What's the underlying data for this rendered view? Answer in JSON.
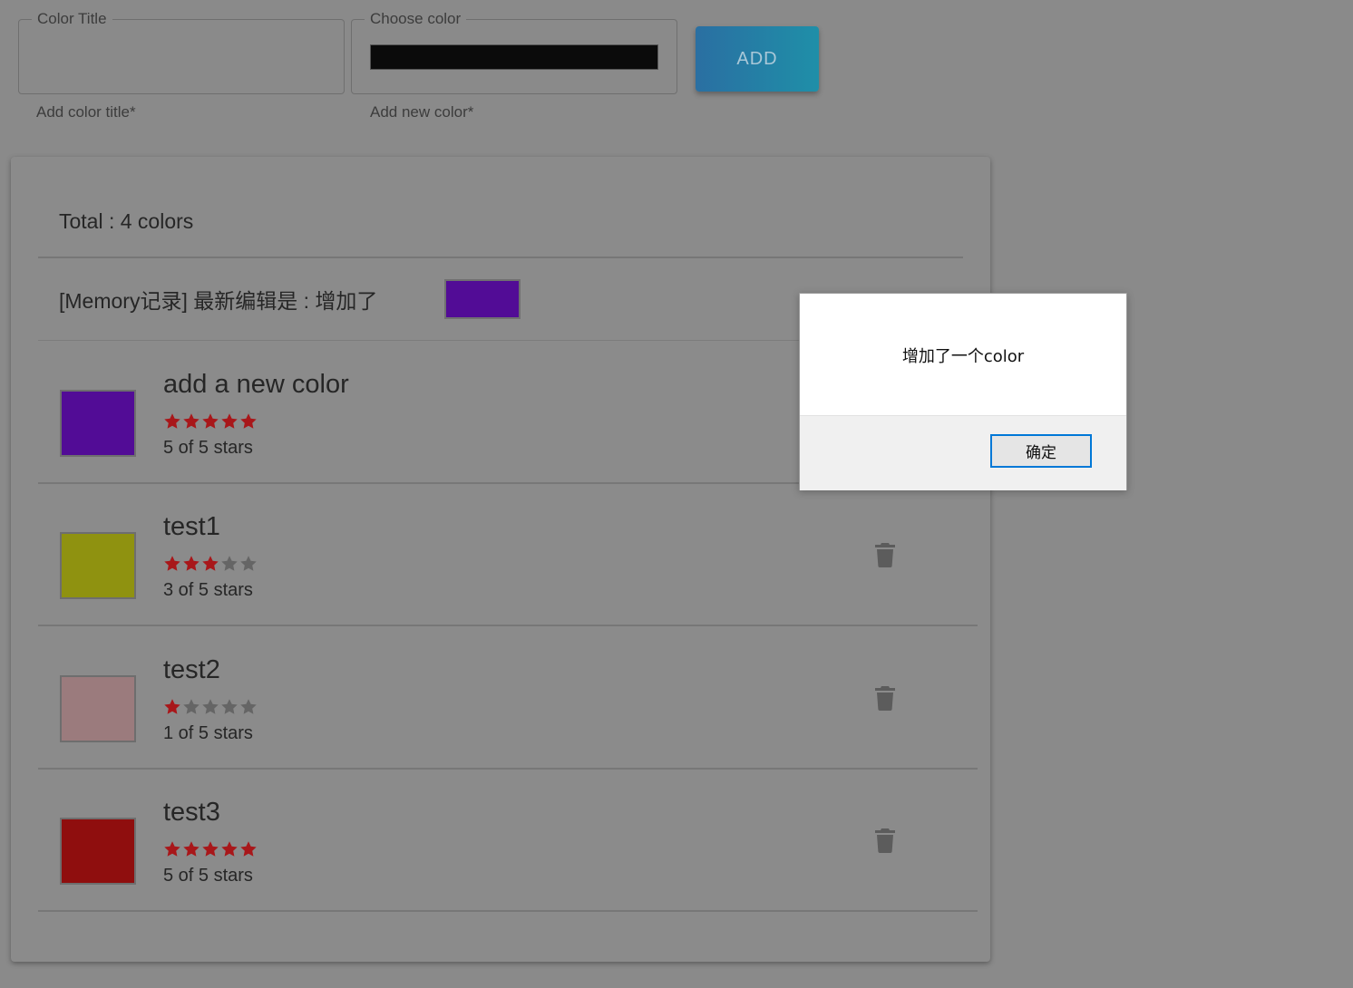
{
  "form": {
    "title_field": {
      "legend": "Color Title",
      "value": "",
      "helper": "Add color title*"
    },
    "color_field": {
      "legend": "Choose color",
      "value_color": "#0b0b0b",
      "helper": "Add new color*"
    },
    "add_label": "ADD"
  },
  "summary": {
    "total_text": "Total : 4 colors",
    "memory_text": "[Memory记录] 最新编辑是 : 增加了",
    "memory_color": "#520c96"
  },
  "colors": [
    {
      "title": "add a new color",
      "color": "#520c96",
      "rating": 5,
      "max": 5,
      "caption": "5 of 5 stars",
      "has_delete": false
    },
    {
      "title": "test1",
      "color": "#8f9210",
      "rating": 3,
      "max": 5,
      "caption": "3 of 5 stars",
      "has_delete": true
    },
    {
      "title": "test2",
      "color": "#9b7b7d",
      "rating": 1,
      "max": 5,
      "caption": "1 of 5 stars",
      "has_delete": true
    },
    {
      "title": "test3",
      "color": "#8f0e0e",
      "rating": 5,
      "max": 5,
      "caption": "5 of 5 stars",
      "has_delete": true
    }
  ],
  "dialog": {
    "message": "增加了一个color",
    "ok_label": "确定"
  },
  "theme": {
    "star_on": "#a8171a",
    "star_off": "#656565",
    "delete_icon": "#5c5c5c",
    "accent": "#1f8fa8"
  }
}
